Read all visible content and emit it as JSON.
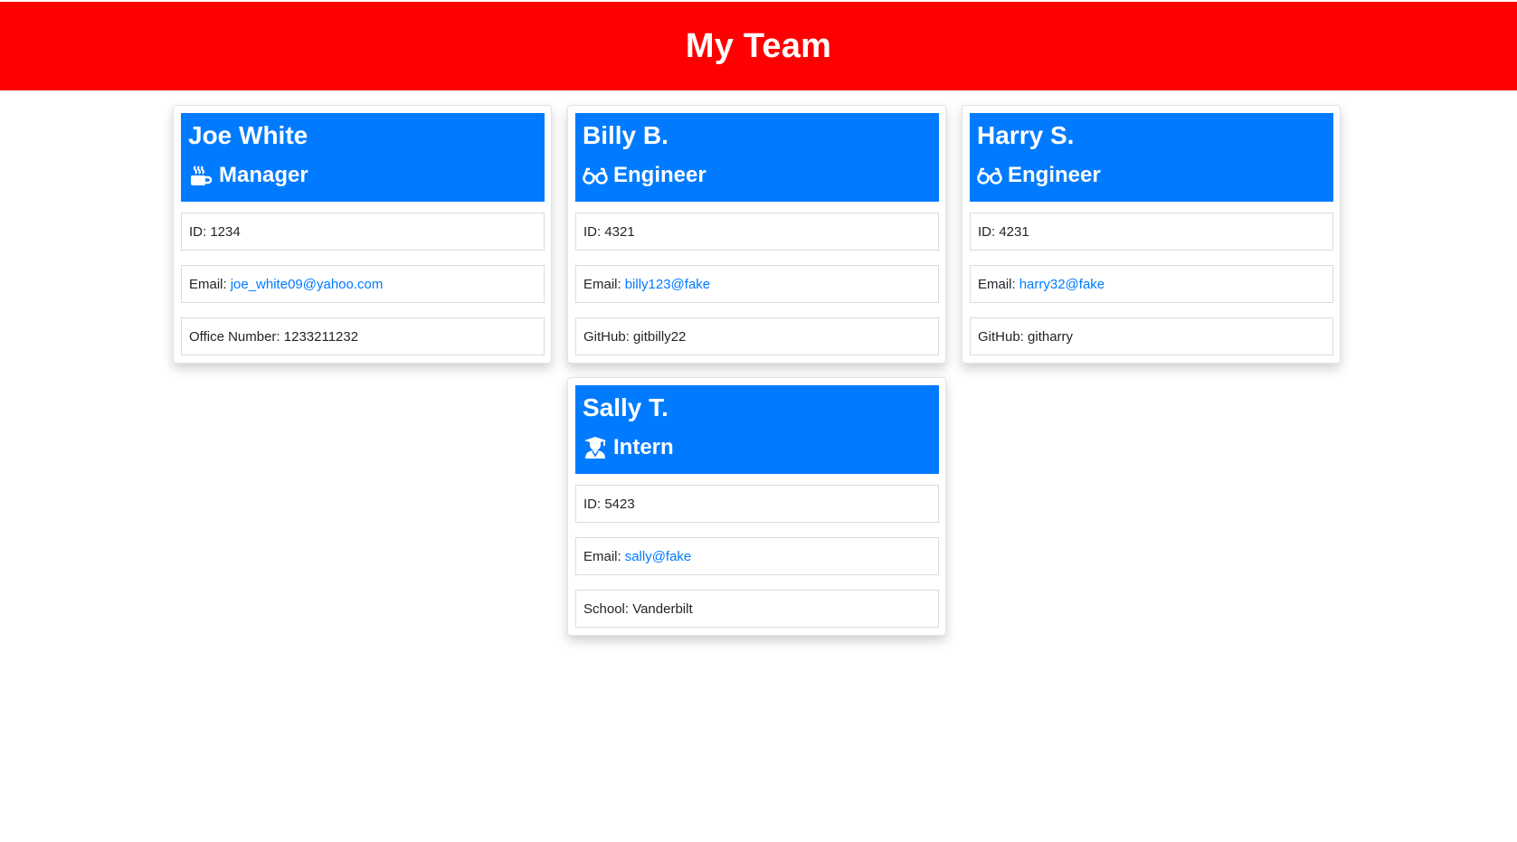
{
  "header": {
    "title": "My Team"
  },
  "colors": {
    "banner": "#ff0000",
    "card_header": "#007bff",
    "link": "#007bff"
  },
  "cards": [
    {
      "name": "Joe White",
      "role": "Manager",
      "role_icon": "coffee-mug-icon",
      "id_text": "ID: 1234",
      "email_label": "Email:",
      "email": "joe_white09@yahoo.com",
      "extra_text": "Office Number: 1233211232"
    },
    {
      "name": "Billy B.",
      "role": "Engineer",
      "role_icon": "glasses-icon",
      "id_text": "ID: 4321",
      "email_label": "Email:",
      "email": "billy123@fake",
      "extra_text": "GitHub: gitbilly22"
    },
    {
      "name": "Harry S.",
      "role": "Engineer",
      "role_icon": "glasses-icon",
      "id_text": "ID: 4231",
      "email_label": "Email:",
      "email": "harry32@fake",
      "extra_text": "GitHub: githarry"
    },
    {
      "name": "Sally T.",
      "role": "Intern",
      "role_icon": "graduate-icon",
      "id_text": "ID: 5423",
      "email_label": "Email:",
      "email": "sally@fake",
      "extra_text": "School: Vanderbilt"
    }
  ]
}
